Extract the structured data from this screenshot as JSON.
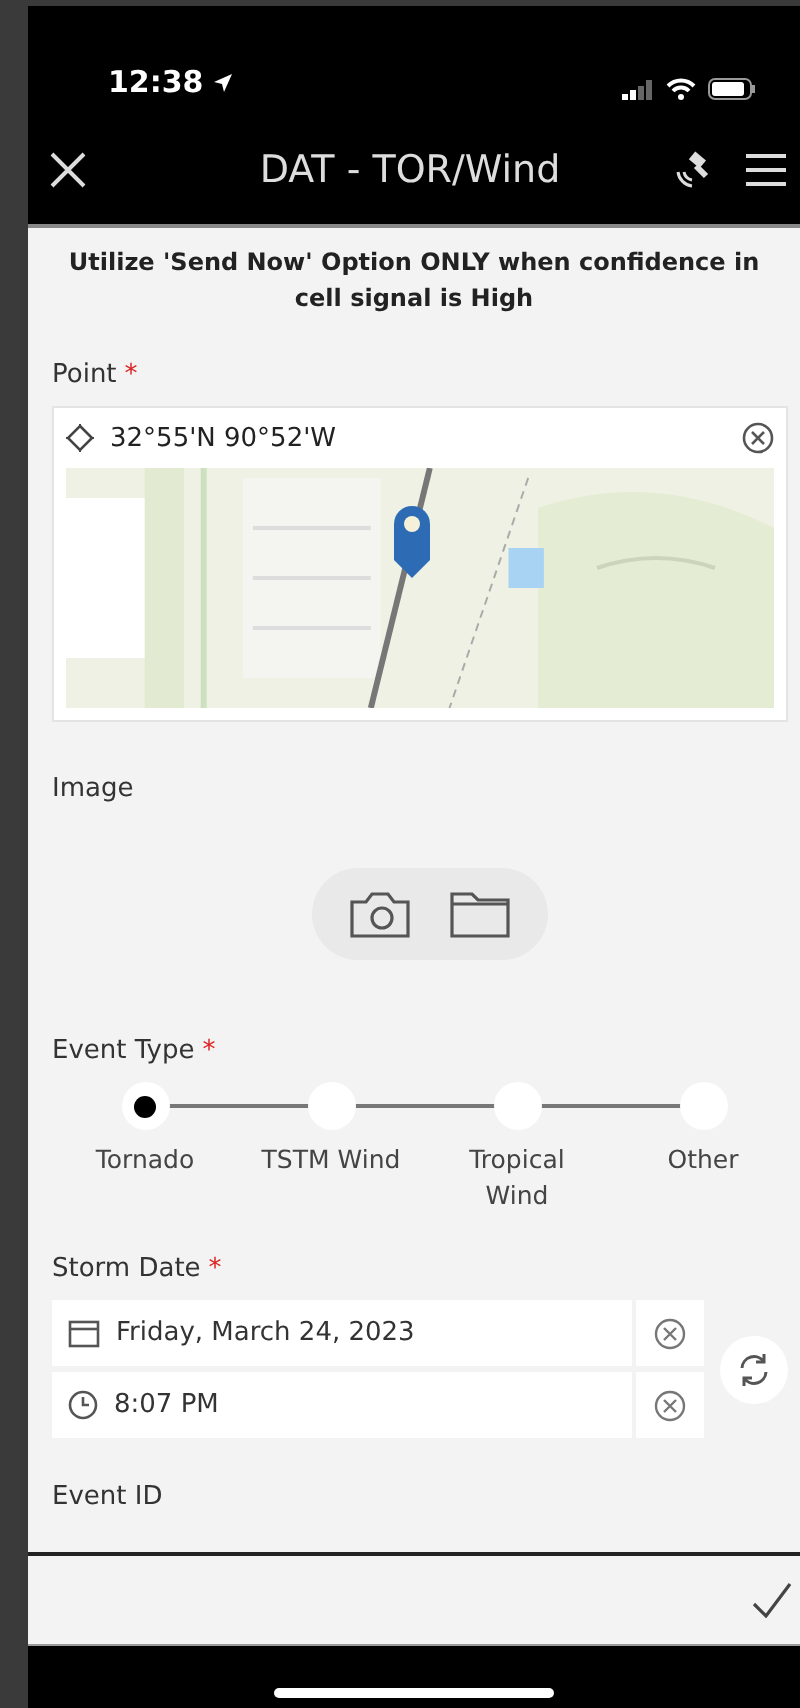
{
  "status_bar": {
    "time": "12:38"
  },
  "header": {
    "title": "DAT - TOR/Wind"
  },
  "notice": "Utilize 'Send Now' Option ONLY when confidence in cell signal is High",
  "point": {
    "label": "Point",
    "required_mark": "*",
    "value": "32°55'N 90°52'W"
  },
  "image": {
    "label": "Image"
  },
  "event_type": {
    "label": "Event Type",
    "required_mark": "*",
    "options": [
      {
        "label": "Tornado",
        "selected": true
      },
      {
        "label": "TSTM Wind",
        "selected": false
      },
      {
        "label": "Tropical Wind",
        "selected": false
      },
      {
        "label": "Other",
        "selected": false
      }
    ]
  },
  "storm_date": {
    "label": "Storm Date",
    "required_mark": "*",
    "date": "Friday, March 24, 2023",
    "time": "8:07 PM"
  },
  "event_id": {
    "label": "Event ID"
  }
}
